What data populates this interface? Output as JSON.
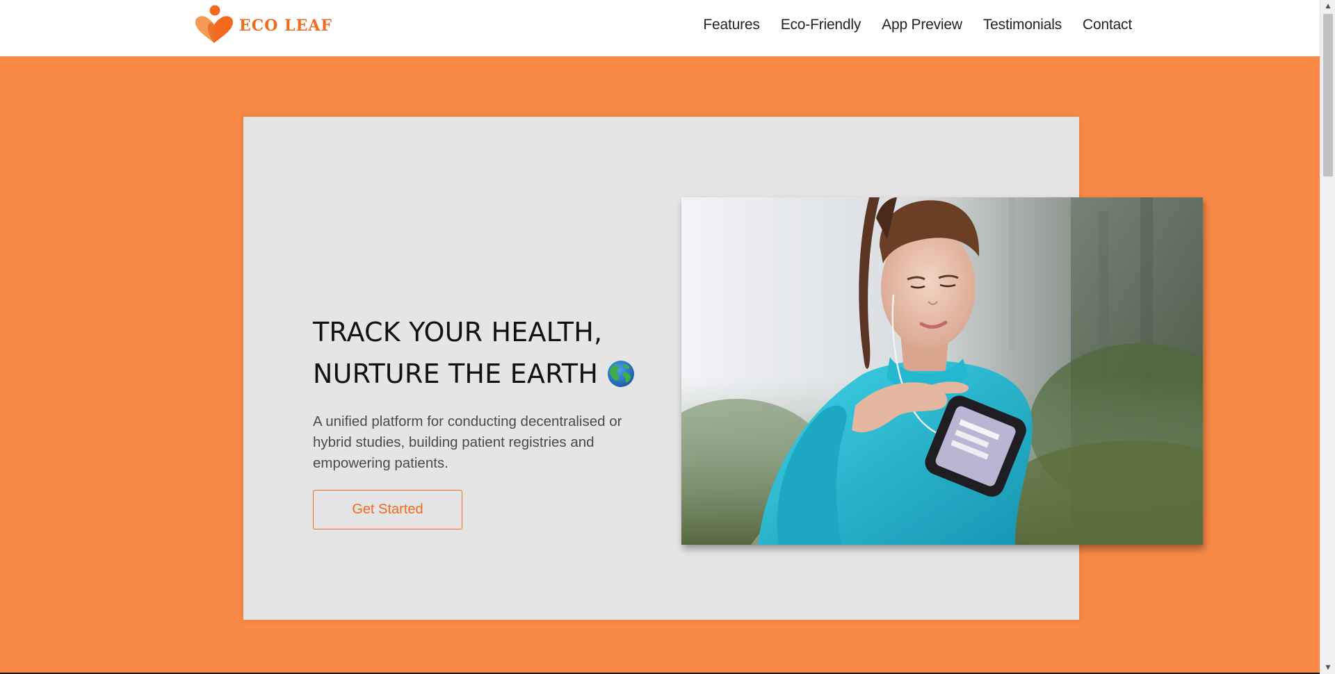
{
  "brand": {
    "name": "ECO LEAF",
    "logo_icon": "heart-leaf-logo-icon",
    "color": "#f36a1d"
  },
  "nav": {
    "items": [
      {
        "label": "Features"
      },
      {
        "label": "Eco-Friendly"
      },
      {
        "label": "App Preview"
      },
      {
        "label": "Testimonials"
      },
      {
        "label": "Contact"
      }
    ]
  },
  "hero": {
    "title_line1": "TRACK YOUR HEALTH,",
    "title_line2": "NURTURE THE EARTH",
    "title_icon": "globe-icon",
    "description": "A unified platform for conducting decentralised or hybrid studies, building patient registries and empowering patients.",
    "cta_label": "Get Started",
    "image_alt": "woman-in-teal-jacket-checking-armband-phone"
  },
  "colors": {
    "background": "#f88946",
    "accent": "#f36a1d",
    "card": "#e6e5e5"
  }
}
